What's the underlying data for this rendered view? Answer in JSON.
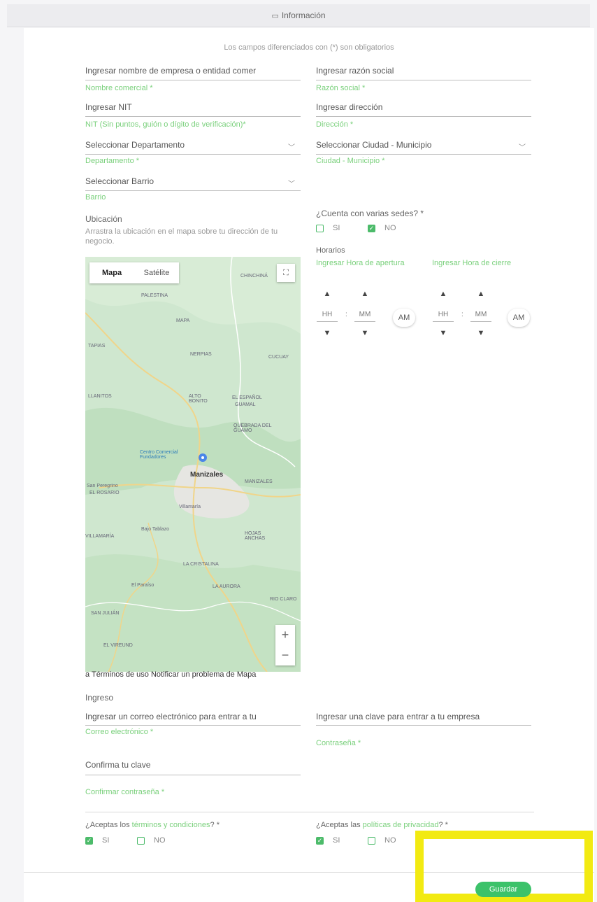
{
  "header": {
    "icon": "info-icon",
    "title": "Información"
  },
  "notice": "Los campos diferenciados con (*) son obligatorios",
  "fields": {
    "nombre": {
      "value": "Ingresar nombre de empresa o entidad comer",
      "label": "Nombre comercial *"
    },
    "razon": {
      "value": "Ingresar razón social",
      "label": "Razón social *"
    },
    "nit": {
      "value": "Ingresar NIT",
      "label": "NIT (Sin puntos, guión o dígito de verificación)*"
    },
    "direccion": {
      "value": "Ingresar dirección",
      "label": "Dirección *"
    },
    "departamento": {
      "value": "Seleccionar Departamento",
      "label": "Departamento *"
    },
    "ciudad": {
      "value": "Seleccionar Ciudad - Municipio",
      "label": "Ciudad - Municipio *"
    },
    "barrio": {
      "value": "Seleccionar Barrio",
      "label": "Barrio"
    }
  },
  "ubicacion": {
    "title": "Ubicación",
    "help": "Arrastra la ubicación en el mapa sobre tu dirección de tu negocio."
  },
  "sedes": {
    "question": "¿Cuenta con varias sedes? *",
    "options": [
      {
        "label": "SI",
        "checked": false
      },
      {
        "label": "NO",
        "checked": true
      }
    ]
  },
  "horarios": {
    "title": "Horarios",
    "open_label": "Ingresar Hora de apertura",
    "close_label": "Ingresar Hora de cierre",
    "hh": "HH",
    "mm": "MM",
    "ampm": "AM",
    "sep": ":"
  },
  "map": {
    "tabs": [
      "Mapa",
      "Satélite"
    ],
    "places": [
      "PALESTINA",
      "CHINCHINÁ",
      "VILLAMARÍA",
      "MANIZALES",
      "Centro Comercial Fundadores",
      "Manizales",
      "ALTO BONITO",
      "EL ESPAÑOL",
      "GUAMAL",
      "QUEBRADA DEL GUAMO",
      "San Peregrino",
      "EL ROSARIO",
      "Villamaría",
      "Bajo Tablazo",
      "HOJAS ANCHAS",
      "LA CRISTALINA",
      "LA AURORA",
      "RIO CLARO",
      "SAN JULIÁN",
      "EL VIREUND",
      "NERPIAS",
      "MAPA",
      "TAPIAS",
      "LLANITOS",
      "CUCUAY",
      "El Paraíso"
    ],
    "zoom_in": "+",
    "zoom_out": "−",
    "fullscreen": "⛶",
    "footer": "a Términos de uso   Notificar un problema de Mapa"
  },
  "ingreso": {
    "title": "Ingreso",
    "correo": {
      "value": "Ingresar un correo electrónico para entrar a tu",
      "label": "Correo electrónico *"
    },
    "clave": {
      "value": "Ingresar una clave para entrar a tu empresa",
      "label": "Contraseña *"
    },
    "confirm": {
      "value": "Confirma tu clave",
      "label": "Confirmar contraseña *"
    }
  },
  "terminos": {
    "prefix": "¿Aceptas los ",
    "link": "términos y condiciones",
    "suffix": "? *",
    "options": [
      {
        "label": "SI",
        "checked": true
      },
      {
        "label": "NO",
        "checked": false
      }
    ]
  },
  "politicas": {
    "prefix": "¿Aceptas las ",
    "link": "políticas de privacidad",
    "suffix": "? *",
    "options": [
      {
        "label": "SI",
        "checked": true
      },
      {
        "label": "NO",
        "checked": false
      }
    ]
  },
  "save_label": "Guardar",
  "colors": {
    "accent": "#3cc26a",
    "label_green": "#7ad07c",
    "highlight": "#f2ea12"
  }
}
